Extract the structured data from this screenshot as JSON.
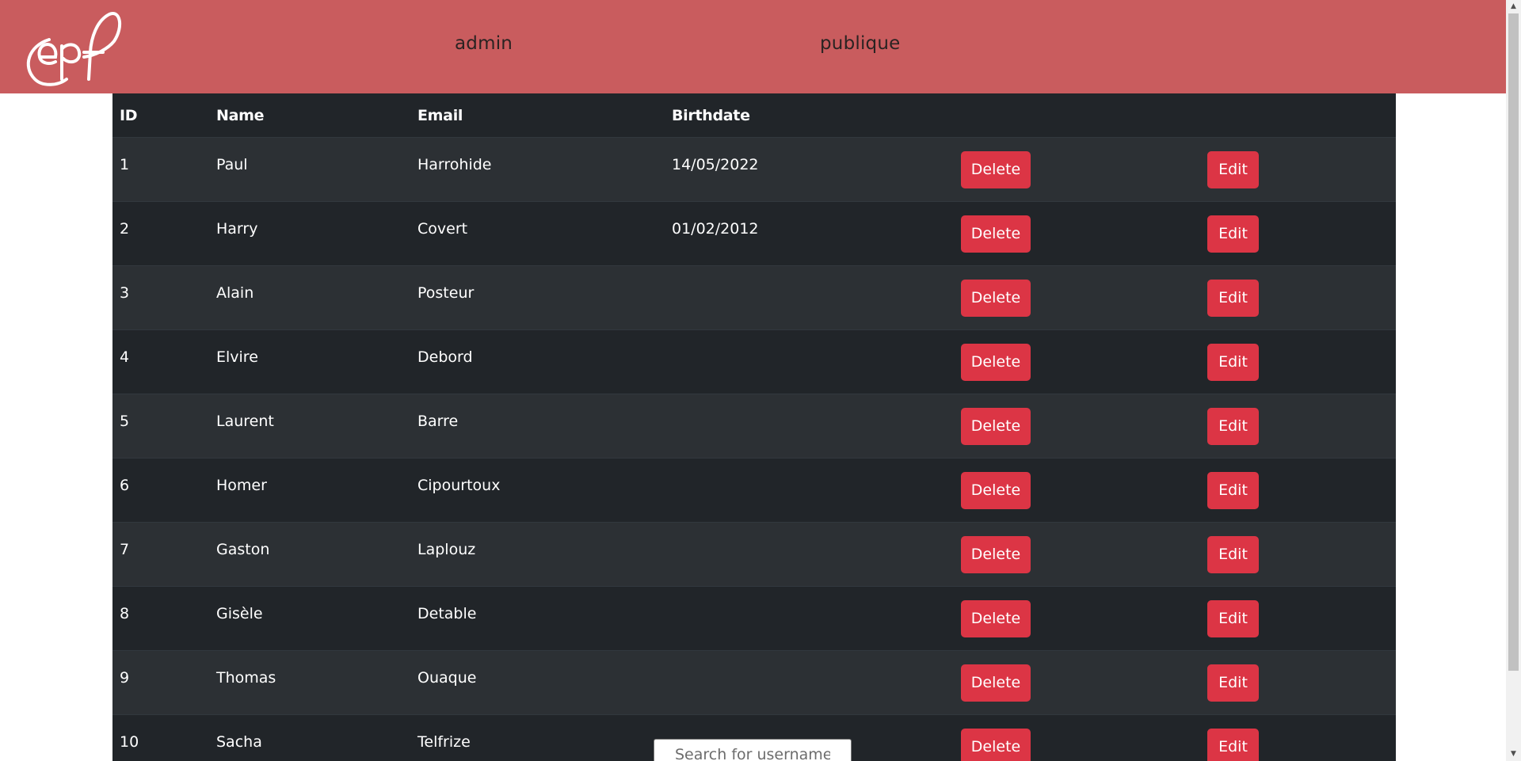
{
  "nav": {
    "logo_alt": "epf",
    "links": [
      "admin",
      "publique"
    ]
  },
  "table": {
    "headers": [
      "ID",
      "Name",
      "Email",
      "Birthdate",
      "",
      ""
    ],
    "rows": [
      {
        "id": "1",
        "name": "Paul",
        "email": "Harrohide",
        "birthdate": "14/05/2022",
        "delete": "Delete",
        "edit": "Edit"
      },
      {
        "id": "2",
        "name": "Harry",
        "email": "Covert",
        "birthdate": "01/02/2012",
        "delete": "Delete",
        "edit": "Edit"
      },
      {
        "id": "3",
        "name": "Alain",
        "email": "Posteur",
        "birthdate": "",
        "delete": "Delete",
        "edit": "Edit"
      },
      {
        "id": "4",
        "name": "Elvire",
        "email": "Debord",
        "birthdate": "",
        "delete": "Delete",
        "edit": "Edit"
      },
      {
        "id": "5",
        "name": "Laurent",
        "email": "Barre",
        "birthdate": "",
        "delete": "Delete",
        "edit": "Edit"
      },
      {
        "id": "6",
        "name": "Homer",
        "email": "Cipourtoux",
        "birthdate": "",
        "delete": "Delete",
        "edit": "Edit"
      },
      {
        "id": "7",
        "name": "Gaston",
        "email": "Laplouz",
        "birthdate": "",
        "delete": "Delete",
        "edit": "Edit"
      },
      {
        "id": "8",
        "name": "Gisèle",
        "email": "Detable",
        "birthdate": "",
        "delete": "Delete",
        "edit": "Edit"
      },
      {
        "id": "9",
        "name": "Thomas",
        "email": "Ouaque",
        "birthdate": "",
        "delete": "Delete",
        "edit": "Edit"
      },
      {
        "id": "10",
        "name": "Sacha",
        "email": "Telfrize",
        "birthdate": "",
        "delete": "Delete",
        "edit": "Edit"
      }
    ]
  },
  "search": {
    "placeholder": "Search for usernames..",
    "value": ""
  },
  "colors": {
    "header_bg": "#c95c5e",
    "table_bg": "#212529",
    "table_stripe": "#2c3034",
    "danger": "#dc3545"
  },
  "icons": {
    "scroll_up": "scroll-up-arrow-icon",
    "scroll_down": "scroll-down-arrow-icon",
    "logo": "epf-logo"
  }
}
